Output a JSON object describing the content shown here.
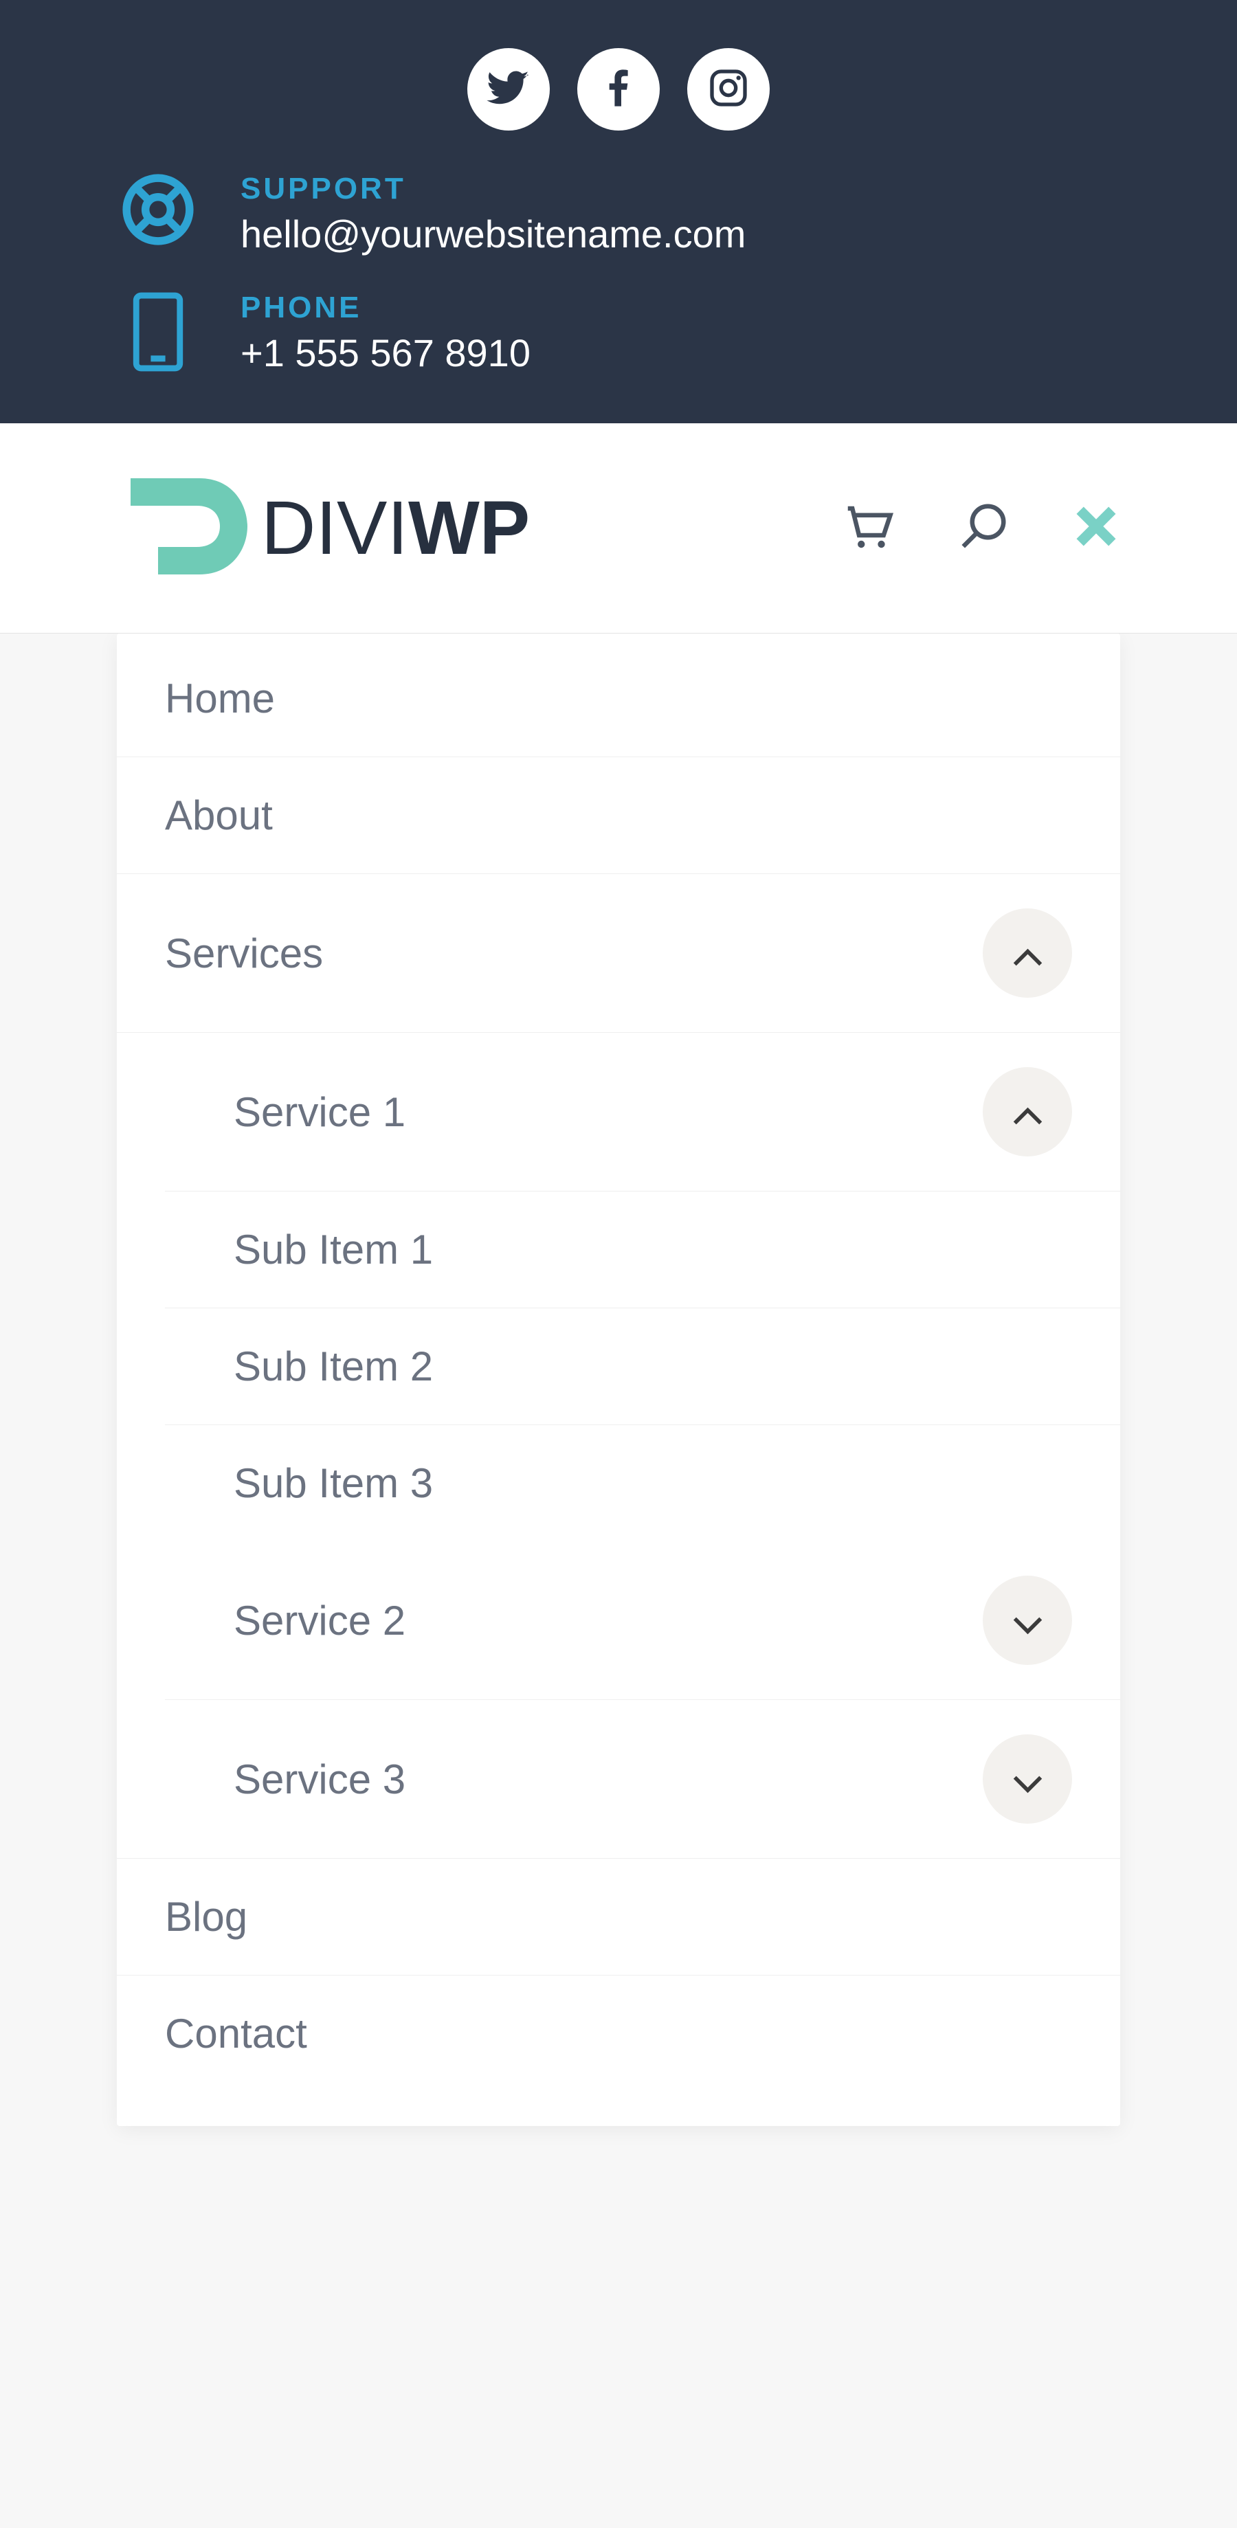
{
  "topbar": {
    "support": {
      "label": "SUPPORT",
      "value": "hello@yourwebsitename.com"
    },
    "phone": {
      "label": "PHONE",
      "value": "+1 555 567 8910"
    }
  },
  "logo": {
    "text_light": "DIVI",
    "text_bold": "WP"
  },
  "menu": {
    "home": "Home",
    "about": "About",
    "services": "Services",
    "service1": "Service 1",
    "sub1": "Sub Item 1",
    "sub2": "Sub Item 2",
    "sub3": "Sub Item 3",
    "service2": "Service 2",
    "service3": "Service 3",
    "blog": "Blog",
    "contact": "Contact"
  }
}
